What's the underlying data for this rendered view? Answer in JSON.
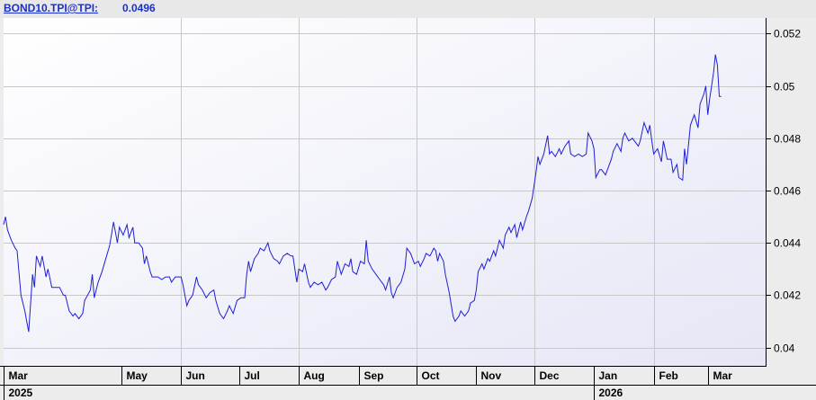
{
  "header": {
    "ticker": "BOND10.TPI@TPI:",
    "last_value": "0.0496"
  },
  "colors": {
    "line": "#1f1fd6",
    "grid": "#c8c8c8",
    "plot_bg_top": "#ffffff",
    "plot_bg_bottom": "#e6e6f6",
    "axis_text": "#000000",
    "header_text": "#1a2fd0"
  },
  "chart_data": {
    "type": "line",
    "title": "",
    "xlabel": "",
    "ylabel": "",
    "y_axis_position": "right",
    "ylim": [
      0.0393,
      0.0526
    ],
    "yticks": [
      0.04,
      0.042,
      0.044,
      0.046,
      0.048,
      0.05,
      0.052
    ],
    "ytick_labels": [
      "0.04",
      "0.042",
      "0.044",
      "0.046",
      "0.048",
      "0.05",
      "0.052"
    ],
    "xlim": [
      "2025-03-01",
      "2026-03-31"
    ],
    "month_labels": [
      {
        "label": "Mar",
        "date": "2025-03-01"
      },
      {
        "label": "May",
        "date": "2025-05-01"
      },
      {
        "label": "Jun",
        "date": "2025-06-01"
      },
      {
        "label": "Jul",
        "date": "2025-07-01"
      },
      {
        "label": "Aug",
        "date": "2025-08-01"
      },
      {
        "label": "Sep",
        "date": "2025-09-01"
      },
      {
        "label": "Oct",
        "date": "2025-10-01"
      },
      {
        "label": "Nov",
        "date": "2025-11-01"
      },
      {
        "label": "Dec",
        "date": "2025-12-01"
      },
      {
        "label": "Jan",
        "date": "2026-01-01"
      },
      {
        "label": "Feb",
        "date": "2026-02-01"
      },
      {
        "label": "Mar",
        "date": "2026-03-01"
      }
    ],
    "year_labels": [
      {
        "label": "2025",
        "date": "2025-03-01"
      },
      {
        "label": "2026",
        "date": "2026-01-01"
      }
    ],
    "vertical_grid_dates": [
      "2025-06-01",
      "2025-08-01",
      "2025-10-01",
      "2025-12-01",
      "2026-02-01"
    ],
    "grid": true,
    "legend": "none",
    "series": [
      {
        "values": [
          [
            "2025-03-01",
            0.0447
          ],
          [
            "2025-03-02",
            0.045
          ],
          [
            "2025-03-03",
            0.0445
          ],
          [
            "2025-03-05",
            0.0441
          ],
          [
            "2025-03-07",
            0.0438
          ],
          [
            "2025-03-08",
            0.0437
          ],
          [
            "2025-03-10",
            0.042
          ],
          [
            "2025-03-12",
            0.0414
          ],
          [
            "2025-03-13",
            0.041
          ],
          [
            "2025-03-14",
            0.0406
          ],
          [
            "2025-03-16",
            0.0428
          ],
          [
            "2025-03-17",
            0.0423
          ],
          [
            "2025-03-18",
            0.0435
          ],
          [
            "2025-03-20",
            0.0431
          ],
          [
            "2025-03-21",
            0.0435
          ],
          [
            "2025-03-23",
            0.0427
          ],
          [
            "2025-03-24",
            0.043
          ],
          [
            "2025-03-26",
            0.0423
          ],
          [
            "2025-03-28",
            0.0423
          ],
          [
            "2025-03-30",
            0.0423
          ],
          [
            "2025-04-01",
            0.042
          ],
          [
            "2025-04-02",
            0.042
          ],
          [
            "2025-04-04",
            0.0414
          ],
          [
            "2025-04-06",
            0.0412
          ],
          [
            "2025-04-07",
            0.0413
          ],
          [
            "2025-04-09",
            0.0411
          ],
          [
            "2025-04-11",
            0.0413
          ],
          [
            "2025-04-12",
            0.0418
          ],
          [
            "2025-04-15",
            0.0422
          ],
          [
            "2025-04-16",
            0.0428
          ],
          [
            "2025-04-17",
            0.0419
          ],
          [
            "2025-04-19",
            0.0425
          ],
          [
            "2025-04-21",
            0.0429
          ],
          [
            "2025-04-23",
            0.0434
          ],
          [
            "2025-04-25",
            0.0439
          ],
          [
            "2025-04-27",
            0.0448
          ],
          [
            "2025-04-29",
            0.044
          ],
          [
            "2025-04-30",
            0.0446
          ],
          [
            "2025-05-02",
            0.0443
          ],
          [
            "2025-05-04",
            0.0447
          ],
          [
            "2025-05-05",
            0.0442
          ],
          [
            "2025-05-07",
            0.0446
          ],
          [
            "2025-05-08",
            0.044
          ],
          [
            "2025-05-10",
            0.044
          ],
          [
            "2025-05-12",
            0.0438
          ],
          [
            "2025-05-13",
            0.0432
          ],
          [
            "2025-05-14",
            0.0435
          ],
          [
            "2025-05-16",
            0.0429
          ],
          [
            "2025-05-17",
            0.0427
          ],
          [
            "2025-05-19",
            0.0427
          ],
          [
            "2025-05-20",
            0.0427
          ],
          [
            "2025-05-22",
            0.0426
          ],
          [
            "2025-05-24",
            0.0427
          ],
          [
            "2025-05-26",
            0.0427
          ],
          [
            "2025-05-27",
            0.0425
          ],
          [
            "2025-05-29",
            0.0427
          ],
          [
            "2025-06-01",
            0.0427
          ],
          [
            "2025-06-02",
            0.0424
          ],
          [
            "2025-06-04",
            0.0416
          ],
          [
            "2025-06-05",
            0.0418
          ],
          [
            "2025-06-07",
            0.042
          ],
          [
            "2025-06-09",
            0.0427
          ],
          [
            "2025-06-10",
            0.0424
          ],
          [
            "2025-06-12",
            0.0422
          ],
          [
            "2025-06-14",
            0.0419
          ],
          [
            "2025-06-16",
            0.0421
          ],
          [
            "2025-06-18",
            0.0422
          ],
          [
            "2025-06-19",
            0.0418
          ],
          [
            "2025-06-21",
            0.0413
          ],
          [
            "2025-06-23",
            0.0411
          ],
          [
            "2025-06-25",
            0.0414
          ],
          [
            "2025-06-26",
            0.0416
          ],
          [
            "2025-06-28",
            0.0413
          ],
          [
            "2025-06-30",
            0.0418
          ],
          [
            "2025-07-02",
            0.0419
          ],
          [
            "2025-07-04",
            0.0419
          ],
          [
            "2025-07-05",
            0.0428
          ],
          [
            "2025-07-06",
            0.0433
          ],
          [
            "2025-07-07",
            0.0429
          ],
          [
            "2025-07-09",
            0.0434
          ],
          [
            "2025-07-11",
            0.0436
          ],
          [
            "2025-07-12",
            0.0438
          ],
          [
            "2025-07-14",
            0.0437
          ],
          [
            "2025-07-16",
            0.044
          ],
          [
            "2025-07-17",
            0.0437
          ],
          [
            "2025-07-19",
            0.0434
          ],
          [
            "2025-07-21",
            0.0433
          ],
          [
            "2025-07-22",
            0.0432
          ],
          [
            "2025-07-24",
            0.0435
          ],
          [
            "2025-07-26",
            0.0436
          ],
          [
            "2025-07-28",
            0.0435
          ],
          [
            "2025-07-29",
            0.0435
          ],
          [
            "2025-07-31",
            0.0425
          ],
          [
            "2025-08-01",
            0.043
          ],
          [
            "2025-08-03",
            0.0429
          ],
          [
            "2025-08-04",
            0.0432
          ],
          [
            "2025-08-06",
            0.0425
          ],
          [
            "2025-08-07",
            0.0423
          ],
          [
            "2025-08-09",
            0.0425
          ],
          [
            "2025-08-11",
            0.0424
          ],
          [
            "2025-08-13",
            0.0425
          ],
          [
            "2025-08-15",
            0.0422
          ],
          [
            "2025-08-16",
            0.0423
          ],
          [
            "2025-08-18",
            0.0426
          ],
          [
            "2025-08-20",
            0.0427
          ],
          [
            "2025-08-21",
            0.0433
          ],
          [
            "2025-08-23",
            0.0428
          ],
          [
            "2025-08-25",
            0.0432
          ],
          [
            "2025-08-27",
            0.0431
          ],
          [
            "2025-08-28",
            0.0434
          ],
          [
            "2025-08-29",
            0.0429
          ],
          [
            "2025-08-31",
            0.0428
          ],
          [
            "2025-09-02",
            0.0433
          ],
          [
            "2025-09-04",
            0.0432
          ],
          [
            "2025-09-05",
            0.0441
          ],
          [
            "2025-09-06",
            0.0433
          ],
          [
            "2025-09-08",
            0.043
          ],
          [
            "2025-09-10",
            0.0428
          ],
          [
            "2025-09-12",
            0.0426
          ],
          [
            "2025-09-14",
            0.0424
          ],
          [
            "2025-09-15",
            0.0422
          ],
          [
            "2025-09-17",
            0.0427
          ],
          [
            "2025-09-18",
            0.0421
          ],
          [
            "2025-09-19",
            0.0419
          ],
          [
            "2025-09-21",
            0.0423
          ],
          [
            "2025-09-23",
            0.0425
          ],
          [
            "2025-09-25",
            0.043
          ],
          [
            "2025-09-26",
            0.0438
          ],
          [
            "2025-09-28",
            0.0436
          ],
          [
            "2025-09-30",
            0.0432
          ],
          [
            "2025-10-02",
            0.0433
          ],
          [
            "2025-10-03",
            0.0431
          ],
          [
            "2025-10-05",
            0.0434
          ],
          [
            "2025-10-06",
            0.0436
          ],
          [
            "2025-10-08",
            0.0435
          ],
          [
            "2025-10-10",
            0.0438
          ],
          [
            "2025-10-11",
            0.0437
          ],
          [
            "2025-10-12",
            0.0433
          ],
          [
            "2025-10-13",
            0.0436
          ],
          [
            "2025-10-15",
            0.0433
          ],
          [
            "2025-10-16",
            0.0428
          ],
          [
            "2025-10-18",
            0.0421
          ],
          [
            "2025-10-20",
            0.0412
          ],
          [
            "2025-10-21",
            0.041
          ],
          [
            "2025-10-23",
            0.0412
          ],
          [
            "2025-10-24",
            0.0414
          ],
          [
            "2025-10-26",
            0.0412
          ],
          [
            "2025-10-28",
            0.0414
          ],
          [
            "2025-10-29",
            0.0417
          ],
          [
            "2025-10-31",
            0.0418
          ],
          [
            "2025-11-01",
            0.0422
          ],
          [
            "2025-11-02",
            0.0429
          ],
          [
            "2025-11-04",
            0.0432
          ],
          [
            "2025-11-05",
            0.043
          ],
          [
            "2025-11-07",
            0.0434
          ],
          [
            "2025-11-08",
            0.0433
          ],
          [
            "2025-11-10",
            0.0437
          ],
          [
            "2025-11-11",
            0.0435
          ],
          [
            "2025-11-13",
            0.0441
          ],
          [
            "2025-11-15",
            0.0438
          ],
          [
            "2025-11-16",
            0.0443
          ],
          [
            "2025-11-18",
            0.0446
          ],
          [
            "2025-11-19",
            0.0444
          ],
          [
            "2025-11-21",
            0.0447
          ],
          [
            "2025-11-22",
            0.0442
          ],
          [
            "2025-11-24",
            0.0448
          ],
          [
            "2025-11-25",
            0.0445
          ],
          [
            "2025-11-27",
            0.045
          ],
          [
            "2025-11-28",
            0.0452
          ],
          [
            "2025-11-30",
            0.0457
          ],
          [
            "2025-12-02",
            0.0467
          ],
          [
            "2025-12-03",
            0.0473
          ],
          [
            "2025-12-04",
            0.047
          ],
          [
            "2025-12-06",
            0.0474
          ],
          [
            "2025-12-08",
            0.0481
          ],
          [
            "2025-12-09",
            0.0474
          ],
          [
            "2025-12-10",
            0.0475
          ],
          [
            "2025-12-12",
            0.0473
          ],
          [
            "2025-12-14",
            0.0476
          ],
          [
            "2025-12-15",
            0.0474
          ],
          [
            "2025-12-17",
            0.0477
          ],
          [
            "2025-12-19",
            0.0479
          ],
          [
            "2025-12-20",
            0.0474
          ],
          [
            "2025-12-22",
            0.0473
          ],
          [
            "2025-12-24",
            0.0474
          ],
          [
            "2025-12-26",
            0.0473
          ],
          [
            "2025-12-28",
            0.0474
          ],
          [
            "2025-12-29",
            0.0482
          ],
          [
            "2025-12-31",
            0.0479
          ],
          [
            "2026-01-01",
            0.0476
          ],
          [
            "2026-01-02",
            0.0465
          ],
          [
            "2026-01-04",
            0.0468
          ],
          [
            "2026-01-05",
            0.0468
          ],
          [
            "2026-01-07",
            0.0466
          ],
          [
            "2026-01-08",
            0.0468
          ],
          [
            "2026-01-10",
            0.0472
          ],
          [
            "2026-01-11",
            0.0475
          ],
          [
            "2026-01-13",
            0.0478
          ],
          [
            "2026-01-15",
            0.0475
          ],
          [
            "2026-01-16",
            0.048
          ],
          [
            "2026-01-17",
            0.0482
          ],
          [
            "2026-01-19",
            0.0479
          ],
          [
            "2026-01-21",
            0.048
          ],
          [
            "2026-01-22",
            0.0479
          ],
          [
            "2026-01-24",
            0.0477
          ],
          [
            "2026-01-25",
            0.0479
          ],
          [
            "2026-01-27",
            0.0486
          ],
          [
            "2026-01-29",
            0.0482
          ],
          [
            "2026-01-30",
            0.0485
          ],
          [
            "2026-01-31",
            0.0479
          ],
          [
            "2026-02-01",
            0.0474
          ],
          [
            "2026-02-03",
            0.0476
          ],
          [
            "2026-02-05",
            0.0471
          ],
          [
            "2026-02-06",
            0.0479
          ],
          [
            "2026-02-08",
            0.0472
          ],
          [
            "2026-02-10",
            0.0472
          ],
          [
            "2026-02-11",
            0.0467
          ],
          [
            "2026-02-13",
            0.047
          ],
          [
            "2026-02-14",
            0.0465
          ],
          [
            "2026-02-16",
            0.0464
          ],
          [
            "2026-02-17",
            0.0476
          ],
          [
            "2026-02-18",
            0.047
          ],
          [
            "2026-02-20",
            0.0485
          ],
          [
            "2026-02-22",
            0.0489
          ],
          [
            "2026-02-24",
            0.0484
          ],
          [
            "2026-02-25",
            0.0493
          ],
          [
            "2026-02-27",
            0.0497
          ],
          [
            "2026-02-28",
            0.05
          ],
          [
            "2026-03-01",
            0.0489
          ],
          [
            "2026-03-02",
            0.0495
          ],
          [
            "2026-03-04",
            0.0505
          ],
          [
            "2026-03-05",
            0.0512
          ],
          [
            "2026-03-06",
            0.0508
          ],
          [
            "2026-03-07",
            0.0496
          ],
          [
            "2026-03-08",
            0.0496
          ]
        ]
      }
    ]
  }
}
